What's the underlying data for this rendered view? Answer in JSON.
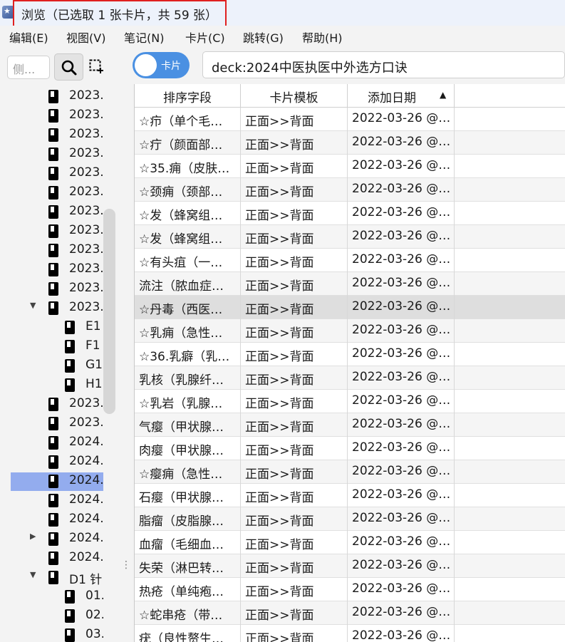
{
  "window": {
    "title": "浏览（已选取 1 张卡片，共 59 张）"
  },
  "menu": [
    "编辑(E)",
    "视图(V)",
    "笔记(N)",
    "卡片(C)",
    "跳转(G)",
    "帮助(H)"
  ],
  "sidebar": {
    "search_placeholder": "侧...",
    "items": [
      {
        "label": "2023.",
        "expander": ""
      },
      {
        "label": "2023.",
        "expander": ""
      },
      {
        "label": "2023.",
        "expander": ""
      },
      {
        "label": "2023.",
        "expander": ""
      },
      {
        "label": "2023.",
        "expander": ""
      },
      {
        "label": "2023.",
        "expander": ""
      },
      {
        "label": "2023.",
        "expander": ""
      },
      {
        "label": "2023.",
        "expander": ""
      },
      {
        "label": "2023.",
        "expander": ""
      },
      {
        "label": "2023.",
        "expander": ""
      },
      {
        "label": "2023.",
        "expander": ""
      },
      {
        "label": "2023.",
        "expander": "expanded"
      },
      {
        "label": "E1",
        "expander": "",
        "child": true
      },
      {
        "label": "F1",
        "expander": "",
        "child": true
      },
      {
        "label": "G1.",
        "expander": "",
        "child": true
      },
      {
        "label": "H1",
        "expander": "",
        "child": true
      },
      {
        "label": "2023.",
        "expander": ""
      },
      {
        "label": "2023.",
        "expander": ""
      },
      {
        "label": "2024.",
        "expander": ""
      },
      {
        "label": "2024.",
        "expander": ""
      },
      {
        "label": "2024.",
        "expander": "",
        "selected": true
      },
      {
        "label": "2024.",
        "expander": ""
      },
      {
        "label": "2024.",
        "expander": ""
      },
      {
        "label": "2024.",
        "expander": "collapsed"
      },
      {
        "label": "2024.",
        "expander": ""
      },
      {
        "label": "D1 针",
        "expander": "expanded"
      },
      {
        "label": "01.",
        "expander": "",
        "child": true
      },
      {
        "label": "02.",
        "expander": "",
        "child": true
      },
      {
        "label": "03.",
        "expander": "",
        "child": true
      }
    ]
  },
  "toggle": {
    "label": "卡片",
    "accent": "#4a90e2"
  },
  "search": {
    "query": "deck:2024中医执医中外选方口诀"
  },
  "table": {
    "columns": [
      "排序字段",
      "卡片模板",
      "添加日期"
    ],
    "sort_indicator": "▲",
    "rows": [
      {
        "sort": "☆疖（单个毛…",
        "template": "正面>>背面",
        "date": "2022-03-26 @…"
      },
      {
        "sort": "☆疔（颜面部…",
        "template": "正面>>背面",
        "date": "2022-03-26 @…"
      },
      {
        "sort": "☆35.痈（皮肤…",
        "template": "正面>>背面",
        "date": "2022-03-26 @…"
      },
      {
        "sort": "☆颈痈（颈部…",
        "template": "正面>>背面",
        "date": "2022-03-26 @…"
      },
      {
        "sort": "☆发（蜂窝组…",
        "template": "正面>>背面",
        "date": "2022-03-26 @…"
      },
      {
        "sort": "☆发（蜂窝组…",
        "template": "正面>>背面",
        "date": "2022-03-26 @…"
      },
      {
        "sort": "☆有头疽（一…",
        "template": "正面>>背面",
        "date": "2022-03-26 @…"
      },
      {
        "sort": "流注（脓血症…",
        "template": "正面>>背面",
        "date": "2022-03-26 @…"
      },
      {
        "sort": "☆丹毒（西医…",
        "template": "正面>>背面",
        "date": "2022-03-26 @…",
        "highlight": true
      },
      {
        "sort": "☆乳痈（急性…",
        "template": "正面>>背面",
        "date": "2022-03-26 @…"
      },
      {
        "sort": "☆36.乳癖（乳…",
        "template": "正面>>背面",
        "date": "2022-03-26 @…"
      },
      {
        "sort": "乳核（乳腺纤…",
        "template": "正面>>背面",
        "date": "2022-03-26 @…"
      },
      {
        "sort": "☆乳岩（乳腺…",
        "template": "正面>>背面",
        "date": "2022-03-26 @…"
      },
      {
        "sort": "气瘿（甲状腺…",
        "template": "正面>>背面",
        "date": "2022-03-26 @…"
      },
      {
        "sort": "肉瘿（甲状腺…",
        "template": "正面>>背面",
        "date": "2022-03-26 @…"
      },
      {
        "sort": "☆瘿痈（急性…",
        "template": "正面>>背面",
        "date": "2022-03-26 @…"
      },
      {
        "sort": "石瘿（甲状腺…",
        "template": "正面>>背面",
        "date": "2022-03-26 @…"
      },
      {
        "sort": "脂瘤（皮脂腺…",
        "template": "正面>>背面",
        "date": "2022-03-26 @…"
      },
      {
        "sort": "血瘤（毛细血…",
        "template": "正面>>背面",
        "date": "2022-03-26 @…"
      },
      {
        "sort": "失荣（淋巴转…",
        "template": "正面>>背面",
        "date": "2022-03-26 @…"
      },
      {
        "sort": "热疮（单纯疱…",
        "template": "正面>>背面",
        "date": "2022-03-26 @…"
      },
      {
        "sort": "☆蛇串疮（带…",
        "template": "正面>>背面",
        "date": "2022-03-26 @…"
      },
      {
        "sort": "疣（良性赘生…",
        "template": "正面>>背面",
        "date": "2022-03-26 @…"
      }
    ]
  },
  "colors": {
    "selection": "#93acee",
    "title_highlight_border": "#e02020"
  }
}
